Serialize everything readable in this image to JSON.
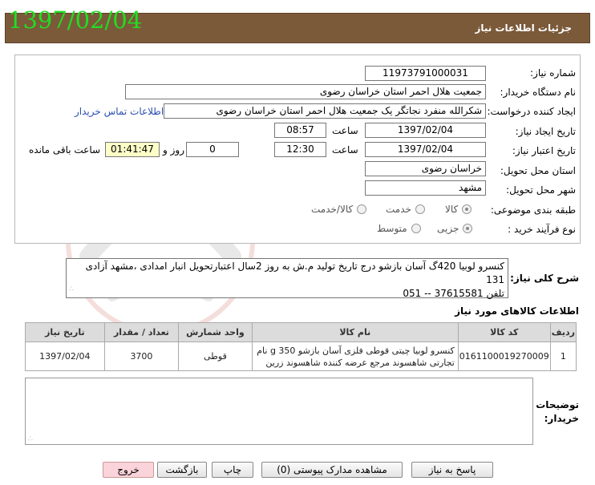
{
  "header": {
    "title": "جزئیات اطلاعات نیاز",
    "date_stamp": "1397/02/04"
  },
  "form": {
    "need_number": {
      "label": "شماره نیاز:",
      "value": "11973791000031"
    },
    "buyer_org": {
      "label": "نام دستگاه خریدار:",
      "value": "جمعیت هلال احمر استان خراسان رضوی"
    },
    "creator": {
      "label": "ایجاد کننده درخواست:",
      "value": "شکرالله منفرد نجاتگر یک جمعیت هلال احمر استان خراسان رضوی",
      "contact_link": "اطلاعات تماس خریدار"
    },
    "created": {
      "label": "تاریخ ایجاد نیاز:",
      "date": "1397/02/04",
      "time_label": "ساعت",
      "time": "08:57"
    },
    "validity": {
      "label": "تاریخ اعتبار نیاز:",
      "date": "1397/02/04",
      "time_label": "ساعت",
      "time": "12:30",
      "days": "0",
      "days_label": "روز و",
      "remaining": "01:41:47",
      "remaining_label": "ساعت باقی مانده"
    },
    "province": {
      "label": "استان محل تحویل:",
      "value": "خراسان رضوی"
    },
    "city": {
      "label": "شهر محل تحویل:",
      "value": "مشهد"
    },
    "category": {
      "label": "طبقه بندی موضوعی:",
      "options": [
        "کالا",
        "خدمت",
        "کالا/خدمت"
      ],
      "selected": "کالا"
    },
    "process": {
      "label": "نوع فرآیند خرید :",
      "options": [
        "جزیی",
        "متوسط"
      ],
      "selected": "جزیی"
    }
  },
  "description": {
    "label": "شرح کلی نیاز:",
    "line1": "کنسرو لوبیا 420گ آسان بازشو درج تاریخ تولید م.ش به روز 2سال اعتبارتحویل انبار امدادی ،مشهد آزادی 131",
    "line2": "تلفن 37615581 -- 051"
  },
  "goods": {
    "title": "اطلاعات کالاهای مورد نیاز",
    "columns": [
      "ردیف",
      "کد کالا",
      "نام کالا",
      "واحد شمارش",
      "تعداد / مقدار",
      "تاریخ نیاز"
    ],
    "rows": [
      {
        "row": "1",
        "code": "0161100019270009",
        "name_line1": "کنسرو لوبیا چیتی قوطی فلزی آسان بازشو 350 g نام",
        "name_line2": "تجارتی شاهسوند مرجع عرضه کننده شاهسوند زرین",
        "unit": "قوطی",
        "qty": "3700",
        "date": "1397/02/04"
      }
    ]
  },
  "notes": {
    "label_line1": "توضیحات",
    "label_line2": "خریدار:"
  },
  "buttons": {
    "reply": "پاسخ به نیاز",
    "attachments": "مشاهده مدارک پیوستی (0)",
    "print": "چاپ",
    "back": "بازگشت",
    "exit": "خروج"
  },
  "colors": {
    "header_bg": "#7b5a3a",
    "date_stamp": "#22dd22",
    "link": "#2c4fb0",
    "exit_button": "#fbd3da"
  }
}
